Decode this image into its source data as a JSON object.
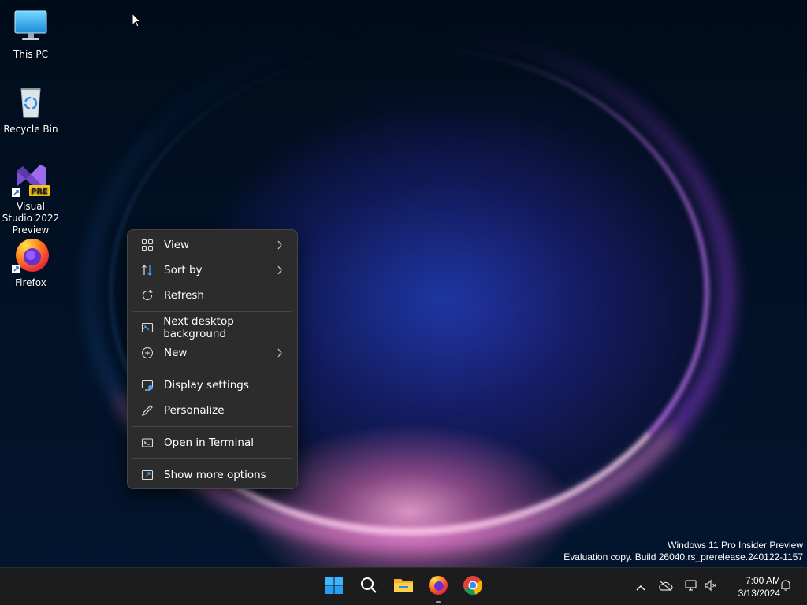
{
  "desktop": {
    "icons": [
      {
        "label": "This PC"
      },
      {
        "label": "Recycle Bin"
      },
      {
        "label": "Visual Studio 2022 Preview",
        "badge": "PRE"
      },
      {
        "label": "Firefox"
      }
    ],
    "watermark": {
      "line1": "Windows 11 Pro Insider Preview",
      "line2": "Evaluation copy. Build 26040.rs_prerelease.240122-1157"
    }
  },
  "context_menu": {
    "items": [
      {
        "label": "View",
        "icon": "view-grid-icon",
        "has_submenu": true
      },
      {
        "label": "Sort by",
        "icon": "sort-icon",
        "has_submenu": true
      },
      {
        "label": "Refresh",
        "icon": "refresh-icon",
        "has_submenu": false
      },
      {
        "label": "Next desktop background",
        "icon": "next-background-icon",
        "has_submenu": false
      },
      {
        "label": "New",
        "icon": "new-plus-icon",
        "has_submenu": true
      },
      {
        "label": "Display settings",
        "icon": "display-settings-icon",
        "has_submenu": false
      },
      {
        "label": "Personalize",
        "icon": "pen-icon",
        "has_submenu": false
      },
      {
        "label": "Open in Terminal",
        "icon": "terminal-icon",
        "has_submenu": false
      },
      {
        "label": "Show more options",
        "icon": "show-more-icon",
        "has_submenu": false
      }
    ]
  },
  "taskbar": {
    "apps": [
      "start-icon",
      "search-icon",
      "file-explorer-icon",
      "firefox-icon",
      "chrome-icon"
    ],
    "tray_icons": [
      "chevron-up-icon",
      "onedrive-offline-icon",
      "network-icon",
      "volume-muted-icon"
    ],
    "clock": {
      "time": "7:00 AM",
      "date": "3/13/2024"
    }
  },
  "colors": {
    "menu_bg": "#2c2c2c",
    "taskbar_bg": "#1c1c1c",
    "accent_blue": "#0078d4"
  }
}
